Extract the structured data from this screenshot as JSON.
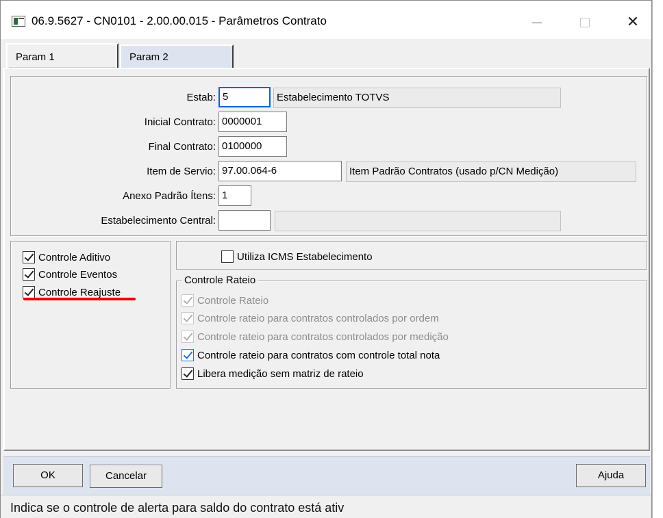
{
  "window": {
    "title": "06.9.5627 - CN0101 - 2.00.00.015 - Parâmetros Contrato",
    "min_glyph": "—",
    "close_glyph": "✕"
  },
  "tabs": [
    {
      "label": "Param 1"
    },
    {
      "label": "Param 2"
    }
  ],
  "form": {
    "estab": {
      "label": "Estab:",
      "value": "5",
      "description": "Estabelecimento TOTVS"
    },
    "inicial_contrato": {
      "label": "Inicial Contrato:",
      "value": "0000001"
    },
    "final_contrato": {
      "label": "Final Contrato:",
      "value": "0100000"
    },
    "item_servico": {
      "label": "Item de Servio:",
      "value": "97.00.064-6",
      "description": "Item Padrão Contratos (usado p/CN Medição)"
    },
    "anexo_padrao": {
      "label": "Anexo Padrão Ítens:",
      "value": "1"
    },
    "estab_central": {
      "label": "Estabelecimento Central:",
      "value": "",
      "description": ""
    }
  },
  "left_checks": [
    {
      "label": "Controle Aditivo",
      "checked": true
    },
    {
      "label": "Controle Eventos",
      "checked": true
    },
    {
      "label": "Controle Reajuste",
      "checked": true
    }
  ],
  "icms": {
    "label": "Utiliza ICMS Estabelecimento",
    "checked": false
  },
  "rateio": {
    "legend": "Controle Rateio",
    "items": [
      {
        "label": "Controle Rateio",
        "checked": true,
        "enabled": false
      },
      {
        "label": "Controle rateio para contratos controlados por ordem",
        "checked": true,
        "enabled": false
      },
      {
        "label": "Controle rateio para contratos controlados por medição",
        "checked": true,
        "enabled": false
      },
      {
        "label": "Controle rateio para contratos com controle total nota",
        "checked": true,
        "enabled": true
      },
      {
        "label": "Libera medição sem matriz de rateio",
        "checked": true,
        "enabled": true
      }
    ]
  },
  "buttons": {
    "ok": "OK",
    "cancel": "Cancelar",
    "help": "Ajuda"
  },
  "status_text": "Indica se o controle de alerta para saldo do contrato está ativ",
  "colors": {
    "bottom_bar": "#dde3ef",
    "annotation_underline": "#ee0000",
    "focus_border": "#0a64c8"
  }
}
